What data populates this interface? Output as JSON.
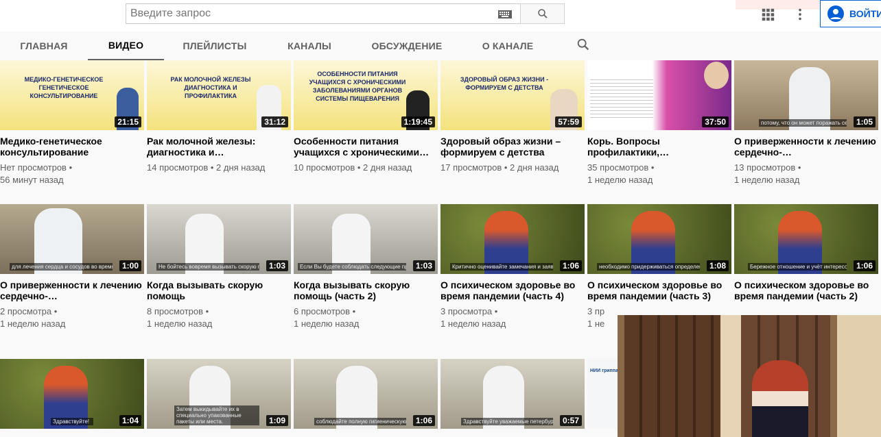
{
  "search": {
    "placeholder": "Введите запрос"
  },
  "header": {
    "signin_label": "ВОЙТИ"
  },
  "tabs": [
    "ГЛАВНАЯ",
    "ВИДЕО",
    "ПЛЕЙЛИСТЫ",
    "КАНАЛЫ",
    "ОБСУЖДЕНИЕ",
    "О КАНАЛЕ"
  ],
  "active_tab": "ВИДЕО",
  "videos": [
    {
      "title": "Медико-генетическое консультирование",
      "views": "Нет просмотров •",
      "age": "56 минут назад",
      "duration": "21:15",
      "slide": "МЕДИКО-ГЕНЕТИЧЕСКОЕ ГЕНЕТИЧЕСКОЕ КОНСУЛЬТИРОВАНИЕ"
    },
    {
      "title": "Рак молочной железы: диагностика и…",
      "views": "14 просмотров • 2 дня назад",
      "age": "",
      "duration": "31:12",
      "slide": "РАК МОЛОЧНОЙ ЖЕЛЕЗЫ ДИАГНОСТИКА И ПРОФИЛАКТИКА"
    },
    {
      "title": "Особенности питания учащихся с хроническими…",
      "views": "10 просмотров • 2 дня назад",
      "age": "",
      "duration": "1:19:45",
      "slide": "ОСОБЕННОСТИ ПИТАНИЯ УЧАЩИХСЯ С ХРОНИЧЕСКИМИ ЗАБОЛЕВАНИЯМИ ОРГАНОВ СИСТЕМЫ ПИЩЕВАРЕНИЯ"
    },
    {
      "title": "Здоровый образ жизни – формируем с детства",
      "views": "17 просмотров • 2 дня назад",
      "age": "",
      "duration": "57:59",
      "slide": "ЗДОРОВЫЙ ОБРАЗ ЖИЗНИ - ФОРМИРУЕМ С ДЕТСТВА"
    },
    {
      "title": "Корь. Вопросы профилактики,…",
      "views": "35 просмотров •",
      "age": "1 неделю назад",
      "duration": "37:50",
      "slide": ""
    },
    {
      "title": "О приверженности к лечению сердечно-…",
      "views": "13 просмотров •",
      "age": "1 неделю назад",
      "duration": "1:05",
      "subtitle": "потому, что он может поражать сердце"
    },
    {
      "title": "О приверженности к лечению сердечно-…",
      "views": "2 просмотра •",
      "age": "1 неделю назад",
      "duration": "1:00",
      "subtitle": "для лечения сердца и сосудов во время пандемии"
    },
    {
      "title": "Когда вызывать скорую помощь",
      "views": "8 просмотров •",
      "age": "1 неделю назад",
      "duration": "1:03",
      "subtitle": "Не бойтесь вовремя вызывать скорую помощь"
    },
    {
      "title": "Когда вызывать скорую помощь (часть 2)",
      "views": "6 просмотров •",
      "age": "1 неделю назад",
      "duration": "1:03",
      "subtitle": "Если Вы будете соблюдать следующие простые правила"
    },
    {
      "title": "О психическом здоровье во время пандемии (часть 4)",
      "views": "3 просмотра •",
      "age": "1 неделю назад",
      "duration": "1:06",
      "subtitle": "Критично оценивайте замечания и заявления"
    },
    {
      "title": "О психическом здоровье во время пандемии (часть 3)",
      "views": "3 пр",
      "age": "1 не",
      "duration": "1:08",
      "subtitle": "необходимо придерживаться определенных правил"
    },
    {
      "title": "О психическом здоровье во время пандемии (часть 2)",
      "views": "",
      "age": "",
      "duration": "1:06",
      "subtitle": "Бережное отношение и учёт интересов близких"
    },
    {
      "title": "",
      "views": "",
      "age": "",
      "duration": "1:04",
      "subtitle": "Здравствуйте!"
    },
    {
      "title": "",
      "views": "",
      "age": "",
      "duration": "1:09",
      "subtitle": "Затем выкидывайте их в специально упакованные пакеты или места."
    },
    {
      "title": "",
      "views": "",
      "age": "",
      "duration": "1:06",
      "subtitle": "соблюдайте полную гигиеническую изоляцию"
    },
    {
      "title": "",
      "views": "",
      "age": "",
      "duration": "0:57",
      "subtitle": "Здравствуйте уважаемые петербуржцы"
    },
    {
      "title": "",
      "views": "",
      "age": "",
      "duration": "",
      "subtitle": "",
      "logo_text": "НИИ гриппа"
    }
  ],
  "colors": {
    "accent": "#065fd4",
    "bg": "#f9f9f9"
  }
}
